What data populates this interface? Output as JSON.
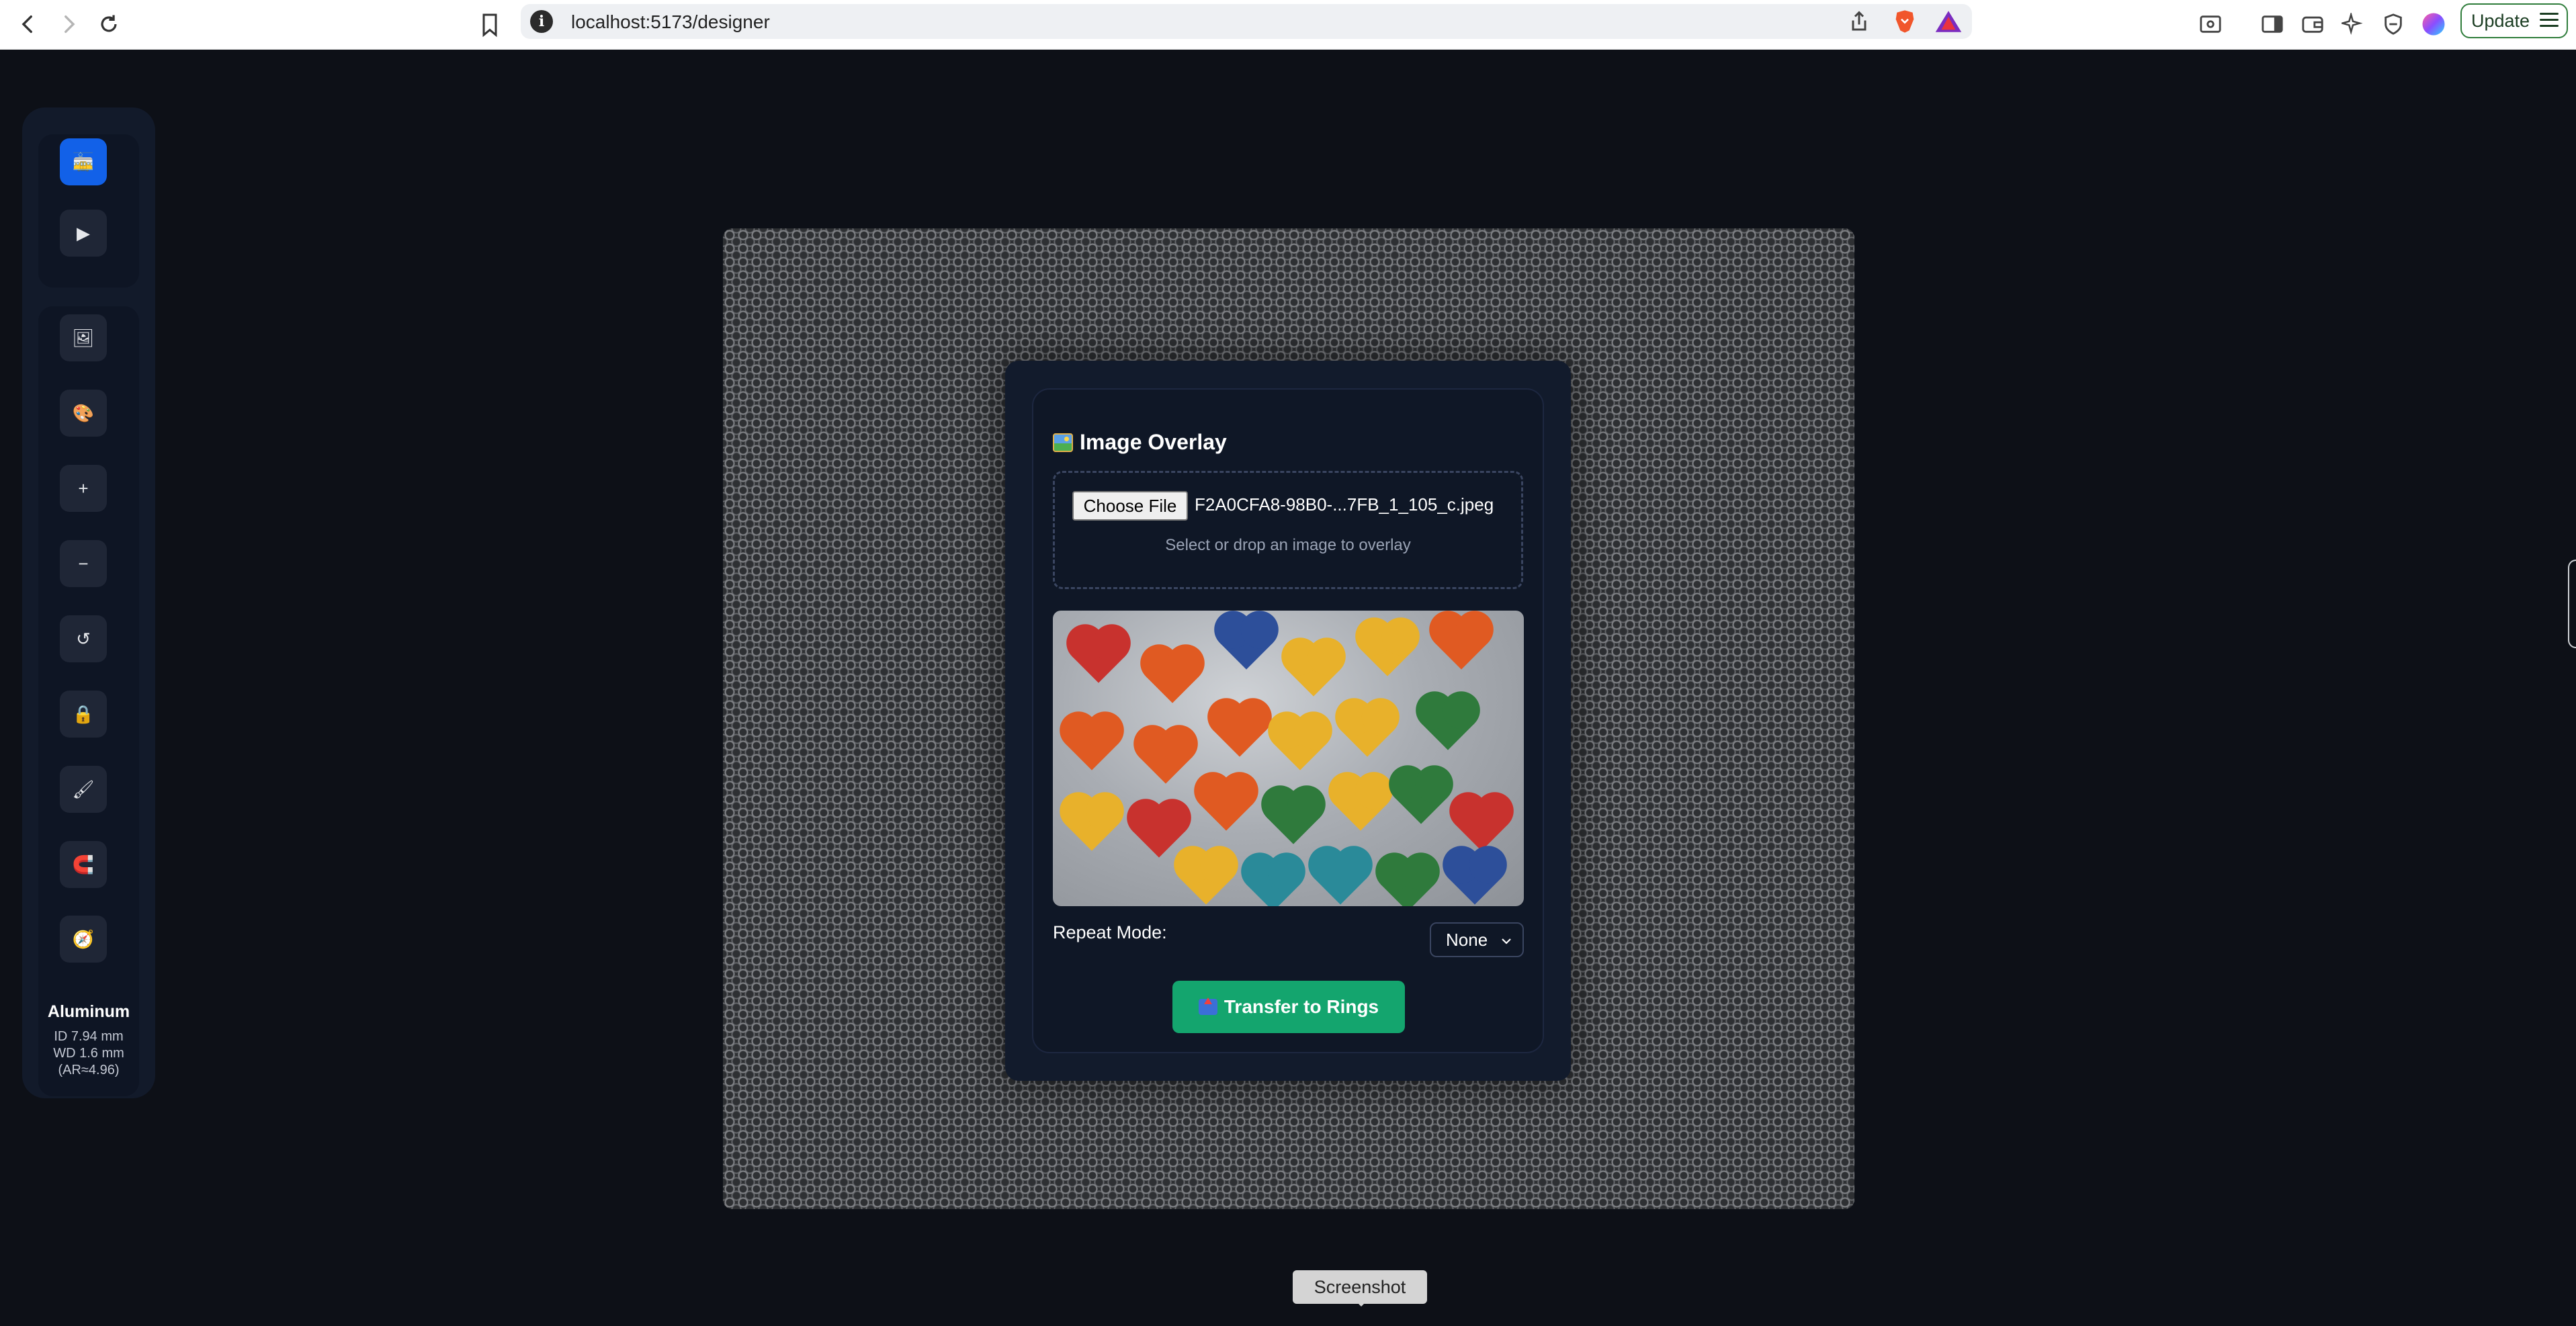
{
  "browser": {
    "url": "localhost:5173/designer",
    "update_label": "Update",
    "info_glyph": "i"
  },
  "sidebar": {
    "tools": [
      {
        "name": "cable-car-icon",
        "glyph": "🚋",
        "active": true
      },
      {
        "name": "play-icon",
        "glyph": "▶",
        "active": false
      },
      {
        "name": "image-icon",
        "glyph": "🖼",
        "active": false
      },
      {
        "name": "palette-icon",
        "glyph": "🎨",
        "active": false
      },
      {
        "name": "zoom-in-icon",
        "glyph": "+",
        "active": false
      },
      {
        "name": "zoom-out-icon",
        "glyph": "−",
        "active": false
      },
      {
        "name": "reset-icon",
        "glyph": "↺",
        "active": false
      },
      {
        "name": "lock-icon",
        "glyph": "🔒",
        "active": false
      },
      {
        "name": "brush-icon",
        "glyph": "🖌",
        "active": false
      },
      {
        "name": "magnet-icon",
        "glyph": "🧲",
        "active": false
      },
      {
        "name": "compass-icon",
        "glyph": "🧭",
        "active": false
      }
    ],
    "material": {
      "name": "Aluminum",
      "id": "ID 7.94 mm",
      "wd": "WD 1.6 mm",
      "ar": "(AR≈4.96)"
    }
  },
  "overlay": {
    "title": "Image Overlay",
    "choose_file_label": "Choose File",
    "file_name": "F2A0CFA8-98B0-...7FB_1_105_c.jpeg",
    "drop_hint": "Select or drop an image to overlay",
    "repeat_label": "Repeat Mode:",
    "repeat_value": "None",
    "transfer_label": "Transfer to Rings"
  },
  "tooltip": {
    "text": "Screenshot"
  }
}
